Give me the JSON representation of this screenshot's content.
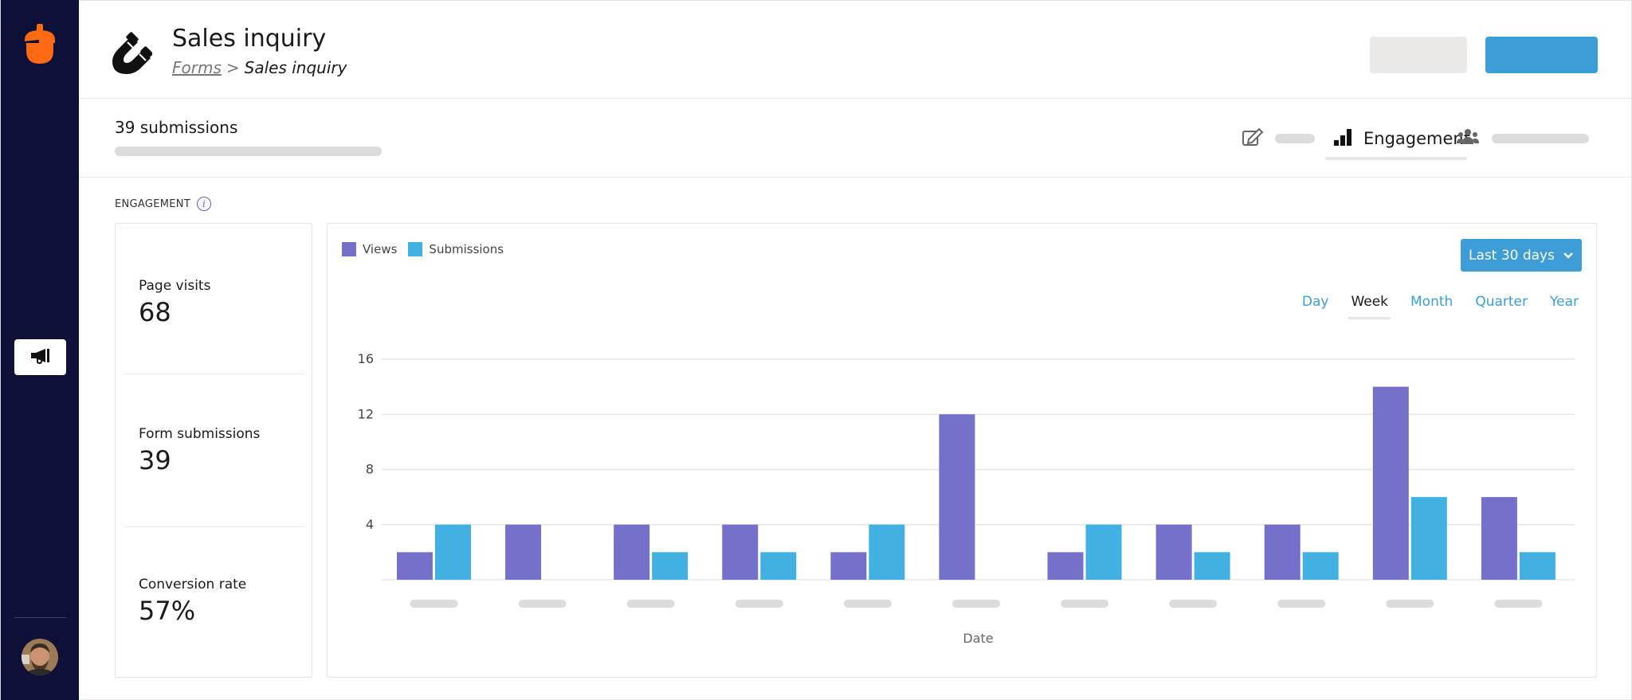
{
  "sidebar": {
    "logo_icon": "acorn-logo-icon",
    "nav_button_icon": "megaphone-icon",
    "avatar_icon": "user-avatar"
  },
  "header": {
    "title": "Sales inquiry",
    "form_icon": "magnet-icon",
    "breadcrumb": {
      "parent": "Forms",
      "separator": ">",
      "current": "Sales inquiry"
    },
    "secondary_button_label": "",
    "primary_button_label": ""
  },
  "subbar": {
    "submissions_count": "39 submissions",
    "tabs": [
      {
        "icon": "edit-icon",
        "label": ""
      },
      {
        "icon": "bar-chart-icon",
        "label": "Engagement",
        "active": true
      },
      {
        "icon": "users-icon",
        "label": ""
      }
    ]
  },
  "engagement": {
    "section_label": "ENGAGEMENT",
    "info_icon_glyph": "i",
    "stats": [
      {
        "label": "Page visits",
        "value": "68"
      },
      {
        "label": "Form submissions",
        "value": "39"
      },
      {
        "label": "Conversion rate",
        "value": "57%"
      }
    ],
    "range_selector": {
      "label": "Last 30 days"
    },
    "periods": [
      {
        "label": "Day",
        "active": false
      },
      {
        "label": "Week",
        "active": true
      },
      {
        "label": "Month",
        "active": false
      },
      {
        "label": "Quarter",
        "active": false
      },
      {
        "label": "Year",
        "active": false
      }
    ],
    "colors": {
      "views": "#7570c9",
      "submissions": "#42b1e1",
      "accent": "#3d9dd6"
    }
  },
  "chart_data": {
    "type": "bar",
    "title": "",
    "xlabel": "Date",
    "ylabel": "",
    "ylim": [
      0,
      16
    ],
    "yticks": [
      4,
      8,
      12,
      16
    ],
    "grid": true,
    "legend": "top-left",
    "categories": [
      "",
      "",
      "",
      "",
      "",
      "",
      "",
      "",
      "",
      "",
      ""
    ],
    "series": [
      {
        "name": "Views",
        "color": "#7570c9",
        "values": [
          2,
          4,
          4,
          4,
          2,
          12,
          2,
          4,
          4,
          14,
          6
        ]
      },
      {
        "name": "Submissions",
        "color": "#42b1e1",
        "values": [
          4,
          0,
          2,
          2,
          4,
          0,
          4,
          2,
          2,
          6,
          2
        ]
      }
    ]
  }
}
